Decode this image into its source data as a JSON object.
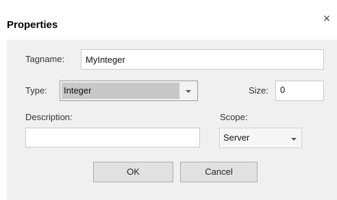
{
  "dialog": {
    "title": "Properties",
    "close_glyph": "×"
  },
  "fields": {
    "tagname_label": "Tagname:",
    "tagname_value": "MyInteger",
    "type_label": "Type:",
    "type_value": "Integer",
    "size_label": "Size:",
    "size_value": "0",
    "description_label": "Description:",
    "description_value": "",
    "scope_label": "Scope:",
    "scope_value": "Server"
  },
  "buttons": {
    "ok": "OK",
    "cancel": "Cancel"
  },
  "icons": {
    "close": "close-icon",
    "dropdown": "chevron-down-icon"
  }
}
